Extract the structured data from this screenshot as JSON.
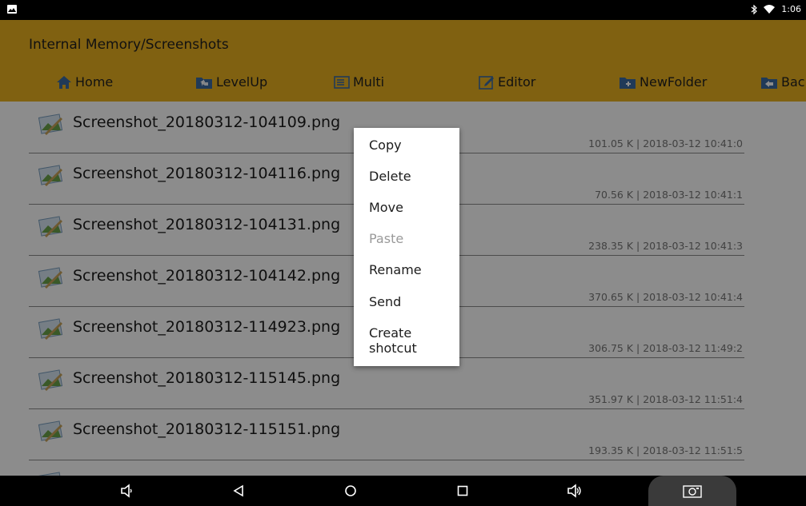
{
  "status_bar": {
    "time": "1:06",
    "left_icon": "gallery-notification-icon",
    "right_icons": [
      "bluetooth-icon",
      "wifi-icon"
    ]
  },
  "app_bar": {
    "path": "Internal Memory/Screenshots",
    "tools": [
      {
        "label": "Home",
        "icon": "home-icon"
      },
      {
        "label": "LevelUp",
        "icon": "level-up-folder-icon"
      },
      {
        "label": "Multi",
        "icon": "multi-select-icon"
      },
      {
        "label": "Editor",
        "icon": "edit-icon"
      },
      {
        "label": "NewFolder",
        "icon": "new-folder-icon"
      },
      {
        "label": "Bac",
        "icon": "back-folder-icon"
      }
    ]
  },
  "files": [
    {
      "name": "Screenshot_20180312-104109.png",
      "meta": "101.05 K | 2018-03-12 10:41:0"
    },
    {
      "name": "Screenshot_20180312-104116.png",
      "meta": "70.56 K | 2018-03-12 10:41:1"
    },
    {
      "name": "Screenshot_20180312-104131.png",
      "meta": "238.35 K | 2018-03-12 10:41:3"
    },
    {
      "name": "Screenshot_20180312-104142.png",
      "meta": "370.65 K | 2018-03-12 10:41:4"
    },
    {
      "name": "Screenshot_20180312-114923.png",
      "meta": "306.75 K | 2018-03-12 11:49:2"
    },
    {
      "name": "Screenshot_20180312-115145.png",
      "meta": "351.97 K | 2018-03-12 11:51:4"
    },
    {
      "name": "Screenshot_20180312-115151.png",
      "meta": "193.35 K | 2018-03-12 11:51:5"
    }
  ],
  "context_menu": {
    "items": [
      {
        "label": "Copy",
        "enabled": true
      },
      {
        "label": "Delete",
        "enabled": true
      },
      {
        "label": "Move",
        "enabled": true
      },
      {
        "label": "Paste",
        "enabled": false
      },
      {
        "label": "Rename",
        "enabled": true
      },
      {
        "label": "Send",
        "enabled": true
      },
      {
        "label": "Create\nshotcut",
        "enabled": true
      }
    ]
  },
  "nav_bar": {
    "buttons": [
      "volume-down-icon",
      "back-icon",
      "home-circle-icon",
      "recents-icon",
      "volume-up-icon",
      "screenshot-camera-icon"
    ]
  },
  "colors": {
    "accent": "#eab120",
    "status_bar": "#000000",
    "dim_overlay": "rgba(0,0,0,0.45)"
  }
}
